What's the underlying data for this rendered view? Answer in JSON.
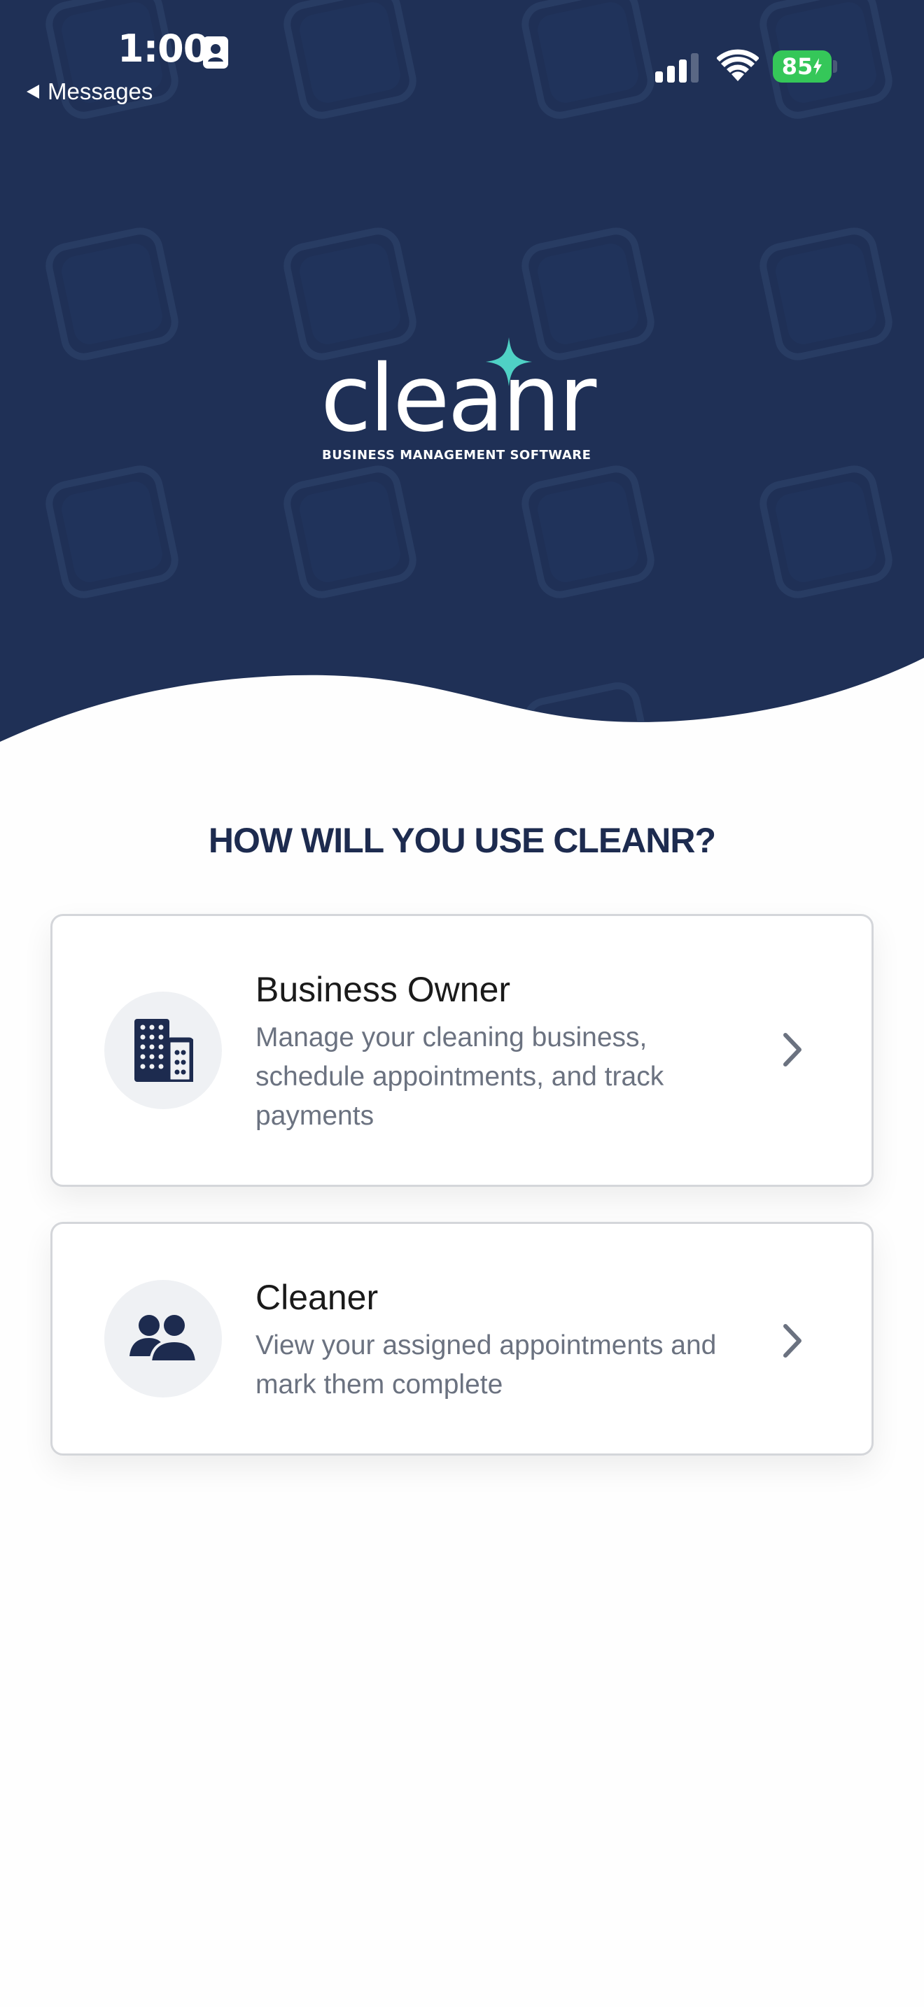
{
  "status_bar": {
    "time": "1:00",
    "back_label": "Messages",
    "battery": "85"
  },
  "brand": {
    "name": "cleanr",
    "tagline": "BUSINESS MANAGEMENT SOFTWARE",
    "colors": {
      "navy": "#1d2f56",
      "accent": "#4fd1c5",
      "text_dark": "#1d2b4f"
    }
  },
  "question": "HOW WILL YOU USE CLEANR?",
  "options": [
    {
      "title": "Business Owner",
      "description": "Manage your cleaning business, schedule appointments, and track payments",
      "icon": "building-icon"
    },
    {
      "title": "Cleaner",
      "description": "View your assigned appointments and mark them complete",
      "icon": "users-icon"
    }
  ]
}
